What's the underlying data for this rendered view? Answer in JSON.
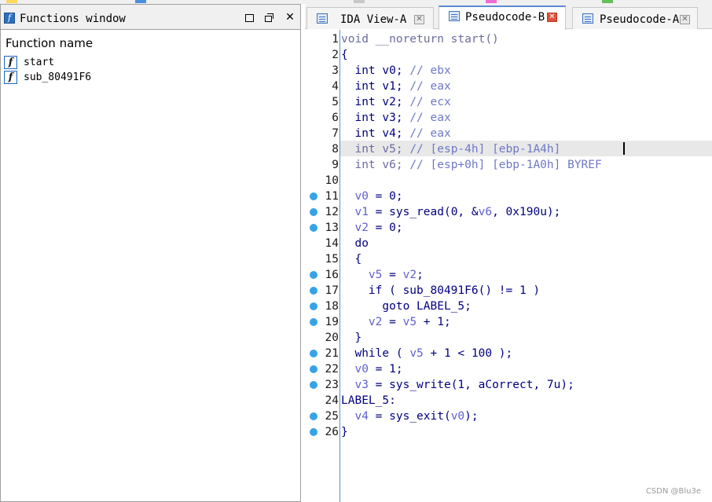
{
  "functions_window": {
    "title": "Functions window",
    "column_header": "Function name",
    "functions": [
      "start",
      "sub_80491F6"
    ],
    "icon": "function-icon"
  },
  "tabs": [
    {
      "label": "IDA View-A",
      "active": false,
      "icon": "disassembly-icon"
    },
    {
      "label": "Pseudocode-B",
      "active": true,
      "icon": "pseudocode-icon"
    },
    {
      "label": "Pseudocode-A",
      "active": false,
      "icon": "pseudocode-icon"
    }
  ],
  "code": {
    "highlighted_line": 8,
    "lines": [
      {
        "num": "1",
        "bp": false,
        "segs": [
          [
            "dim",
            "void __noreturn start()"
          ]
        ]
      },
      {
        "num": "2",
        "bp": false,
        "segs": [
          [
            "plain",
            "{"
          ]
        ]
      },
      {
        "num": "3",
        "bp": false,
        "segs": [
          [
            "plain",
            "  int v0; "
          ],
          [
            "cmt",
            "// ebx"
          ]
        ]
      },
      {
        "num": "4",
        "bp": false,
        "segs": [
          [
            "plain",
            "  int v1; "
          ],
          [
            "cmt",
            "// eax"
          ]
        ]
      },
      {
        "num": "5",
        "bp": false,
        "segs": [
          [
            "plain",
            "  int v2; "
          ],
          [
            "cmt",
            "// ecx"
          ]
        ]
      },
      {
        "num": "6",
        "bp": false,
        "segs": [
          [
            "plain",
            "  int v3; "
          ],
          [
            "cmt",
            "// eax"
          ]
        ]
      },
      {
        "num": "7",
        "bp": false,
        "segs": [
          [
            "plain",
            "  int v4; "
          ],
          [
            "cmt",
            "// eax"
          ]
        ]
      },
      {
        "num": "8",
        "bp": false,
        "segs": [
          [
            "dim",
            "  int v5; "
          ],
          [
            "cmt",
            "// [esp-4h] [ebp-1A4h]"
          ]
        ]
      },
      {
        "num": "9",
        "bp": false,
        "segs": [
          [
            "dim",
            "  int v6; "
          ],
          [
            "cmt",
            "// [esp+0h] [ebp-1A0h] BYREF"
          ]
        ]
      },
      {
        "num": "10",
        "bp": false,
        "segs": [
          [
            "plain",
            ""
          ]
        ]
      },
      {
        "num": "11",
        "bp": true,
        "segs": [
          [
            "plain",
            "  "
          ],
          [
            "var",
            "v0"
          ],
          [
            "plain",
            " = 0;"
          ]
        ]
      },
      {
        "num": "12",
        "bp": true,
        "segs": [
          [
            "plain",
            "  "
          ],
          [
            "var",
            "v1"
          ],
          [
            "plain",
            " = sys_read(0, &"
          ],
          [
            "var",
            "v6"
          ],
          [
            "plain",
            ", 0x190u);"
          ]
        ]
      },
      {
        "num": "13",
        "bp": true,
        "segs": [
          [
            "plain",
            "  "
          ],
          [
            "var",
            "v2"
          ],
          [
            "plain",
            " = 0;"
          ]
        ]
      },
      {
        "num": "14",
        "bp": false,
        "segs": [
          [
            "plain",
            "  do"
          ]
        ]
      },
      {
        "num": "15",
        "bp": false,
        "segs": [
          [
            "plain",
            "  {"
          ]
        ]
      },
      {
        "num": "16",
        "bp": true,
        "segs": [
          [
            "plain",
            "    "
          ],
          [
            "var",
            "v5"
          ],
          [
            "plain",
            " = "
          ],
          [
            "var",
            "v2"
          ],
          [
            "plain",
            ";"
          ]
        ]
      },
      {
        "num": "17",
        "bp": true,
        "segs": [
          [
            "plain",
            "    if ( sub_80491F6() != 1 )"
          ]
        ]
      },
      {
        "num": "18",
        "bp": true,
        "segs": [
          [
            "plain",
            "      goto LABEL_5;"
          ]
        ]
      },
      {
        "num": "19",
        "bp": true,
        "segs": [
          [
            "plain",
            "    "
          ],
          [
            "var",
            "v2"
          ],
          [
            "plain",
            " = "
          ],
          [
            "var",
            "v5"
          ],
          [
            "plain",
            " + 1;"
          ]
        ]
      },
      {
        "num": "20",
        "bp": false,
        "segs": [
          [
            "plain",
            "  }"
          ]
        ]
      },
      {
        "num": "21",
        "bp": true,
        "segs": [
          [
            "plain",
            "  while ( "
          ],
          [
            "var",
            "v5"
          ],
          [
            "plain",
            " + 1 < 100 );"
          ]
        ]
      },
      {
        "num": "22",
        "bp": true,
        "segs": [
          [
            "plain",
            "  "
          ],
          [
            "var",
            "v0"
          ],
          [
            "plain",
            " = 1;"
          ]
        ]
      },
      {
        "num": "23",
        "bp": true,
        "segs": [
          [
            "plain",
            "  "
          ],
          [
            "var",
            "v3"
          ],
          [
            "plain",
            " = sys_write(1, aCorrect, 7u);"
          ]
        ]
      },
      {
        "num": "24",
        "bp": false,
        "segs": [
          [
            "plain",
            "LABEL_5:"
          ]
        ]
      },
      {
        "num": "25",
        "bp": true,
        "segs": [
          [
            "plain",
            "  "
          ],
          [
            "var",
            "v4"
          ],
          [
            "plain",
            " = sys_exit("
          ],
          [
            "var",
            "v0"
          ],
          [
            "plain",
            ");"
          ]
        ]
      },
      {
        "num": "26",
        "bp": true,
        "segs": [
          [
            "plain",
            "}"
          ]
        ]
      }
    ]
  },
  "watermark": "CSDN @Blu3e",
  "colors": {
    "keyword_text": "#00007f",
    "comment": "#6f78c7",
    "variable": "#5f5fd0",
    "breakpoint": "#36a3e8",
    "gutter_line": "#5b8fc9",
    "highlight": "#e8e8e8",
    "active_tab_close": "#e0503c"
  }
}
